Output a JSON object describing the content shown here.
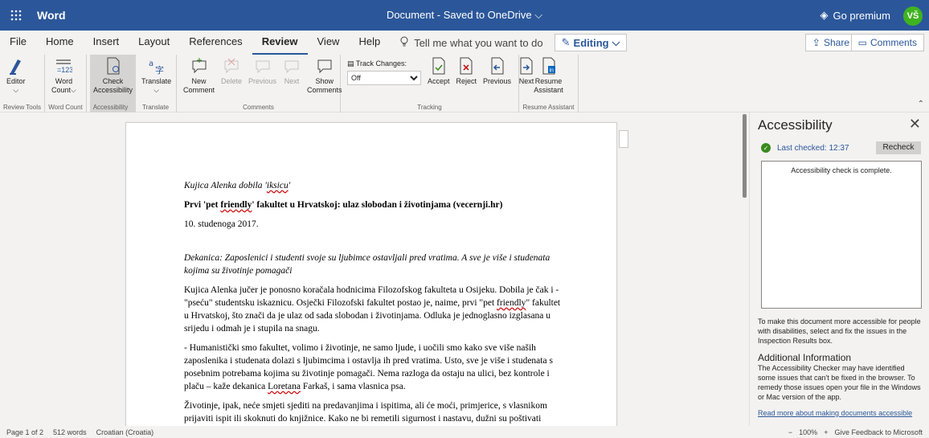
{
  "titlebar": {
    "app_name": "Word",
    "doc_title": "Document - Saved to OneDrive",
    "go_premium": "Go premium",
    "avatar_initials": "VŠ"
  },
  "tabs": [
    "File",
    "Home",
    "Insert",
    "Layout",
    "References",
    "Review",
    "View",
    "Help"
  ],
  "active_tab": "Review",
  "tell_me": "Tell me what you want to do",
  "editing_label": "Editing",
  "share_label": "Share",
  "comments_label": "Comments",
  "ribbon": {
    "editor": "Editor",
    "review_tools": "Review Tools",
    "word_count_l1": "Word",
    "word_count_l2": "Count",
    "word_count_group": "Word Count",
    "check_l1": "Check",
    "check_l2": "Accessibility",
    "accessibility_group": "Accessibility",
    "translate": "Translate",
    "translate_group": "Translate",
    "new_l1": "New",
    "new_l2": "Comment",
    "delete": "Delete",
    "previous": "Previous",
    "next": "Next",
    "show_l1": "Show",
    "show_l2": "Comments",
    "comments_group": "Comments",
    "track_changes": "Track Changes:",
    "track_value": "Off",
    "accept": "Accept",
    "reject": "Reject",
    "tr_previous": "Previous",
    "tr_next": "Next",
    "tracking_group": "Tracking",
    "resume_l1": "Resume",
    "resume_l2": "Assistant",
    "resume_group": "Resume Assistant"
  },
  "document": {
    "p1_a": "Kujica Alenka dobila '",
    "p1_b": "iksicu",
    "p1_c": "'",
    "p2_a": "Prvi 'pet ",
    "p2_b": "friendly",
    "p2_c": "' fakultet u Hrvatskoj: ulaz slobodan i životinjama (vecernji.hr)",
    "p3": "10. studenoga 2017.",
    "p4": "Dekanica: Zaposlenici i studenti svoje su ljubimce ostavljali pred vratima. A sve je više i studenata kojima su životinje pomagači",
    "p5_a": "Kujica Alenka jučer je ponosno koračala hodnicima Filozofskog fakulteta u Osijeku. Dobila je čak i - \"pseću\" studentsku iskaznicu. Osječki Filozofski fakultet postao je, naime, prvi \"pet ",
    "p5_b": "friendly",
    "p5_c": "\" fakultet u Hrvatskoj, što znači da je ulaz od sada slobodan i životinjama. Odluka je jednoglasno izglasana u srijedu i odmah je i stupila na snagu.",
    "p6_a": "- Humanistički smo fakultet, volimo i životinje, ne samo ljude, i uočili smo kako sve više naših zaposlenika i studenata dolazi s ljubimcima i ostavlja ih pred vratima. Usto, sve je više i studenata s posebnim potrebama kojima su životinje pomagači. Nema razloga da ostaju na ulici, bez kontrole i plaču – kaže dekanica ",
    "p6_b": "Loretana",
    "p6_c": " Farkaš, i sama vlasnica psa.",
    "p7": "Životinje, ipak, neće smjeti sjediti na predavanjima i ispitima, ali će moći, primjerice, s vlasnikom prijaviti ispit ili skoknuti do knjižnice. Kako ne bi remetili sigurnost i nastavu, dužni su poštivati pravila. Kada ulaze u zgradu, morat će ih se prijaviti na porti, navesti kamo su se"
  },
  "pane": {
    "title": "Accessibility",
    "last_checked": "Last checked: 12:37",
    "recheck": "Recheck",
    "result": "Accessibility check is complete.",
    "info": "To make this document more accessible for people with disabilities, select and fix the issues in the Inspection Results box.",
    "addl_title": "Additional Information",
    "addl_text": "The Accessibility Checker may have identified some issues that can't be fixed in the browser. To remedy those issues open your file in the Windows or Mac version of the app.",
    "link": "Read more about making documents accessible"
  },
  "status": {
    "page": "Page 1 of 2",
    "words": "512 words",
    "language": "Croatian (Croatia)",
    "zoom_minus": "−",
    "zoom": "100%",
    "zoom_plus": "+",
    "feedback": "Give Feedback to Microsoft"
  },
  "colors": {
    "brand": "#2b579a",
    "avatar": "#3fb31f",
    "ok": "#3a8a1f"
  }
}
